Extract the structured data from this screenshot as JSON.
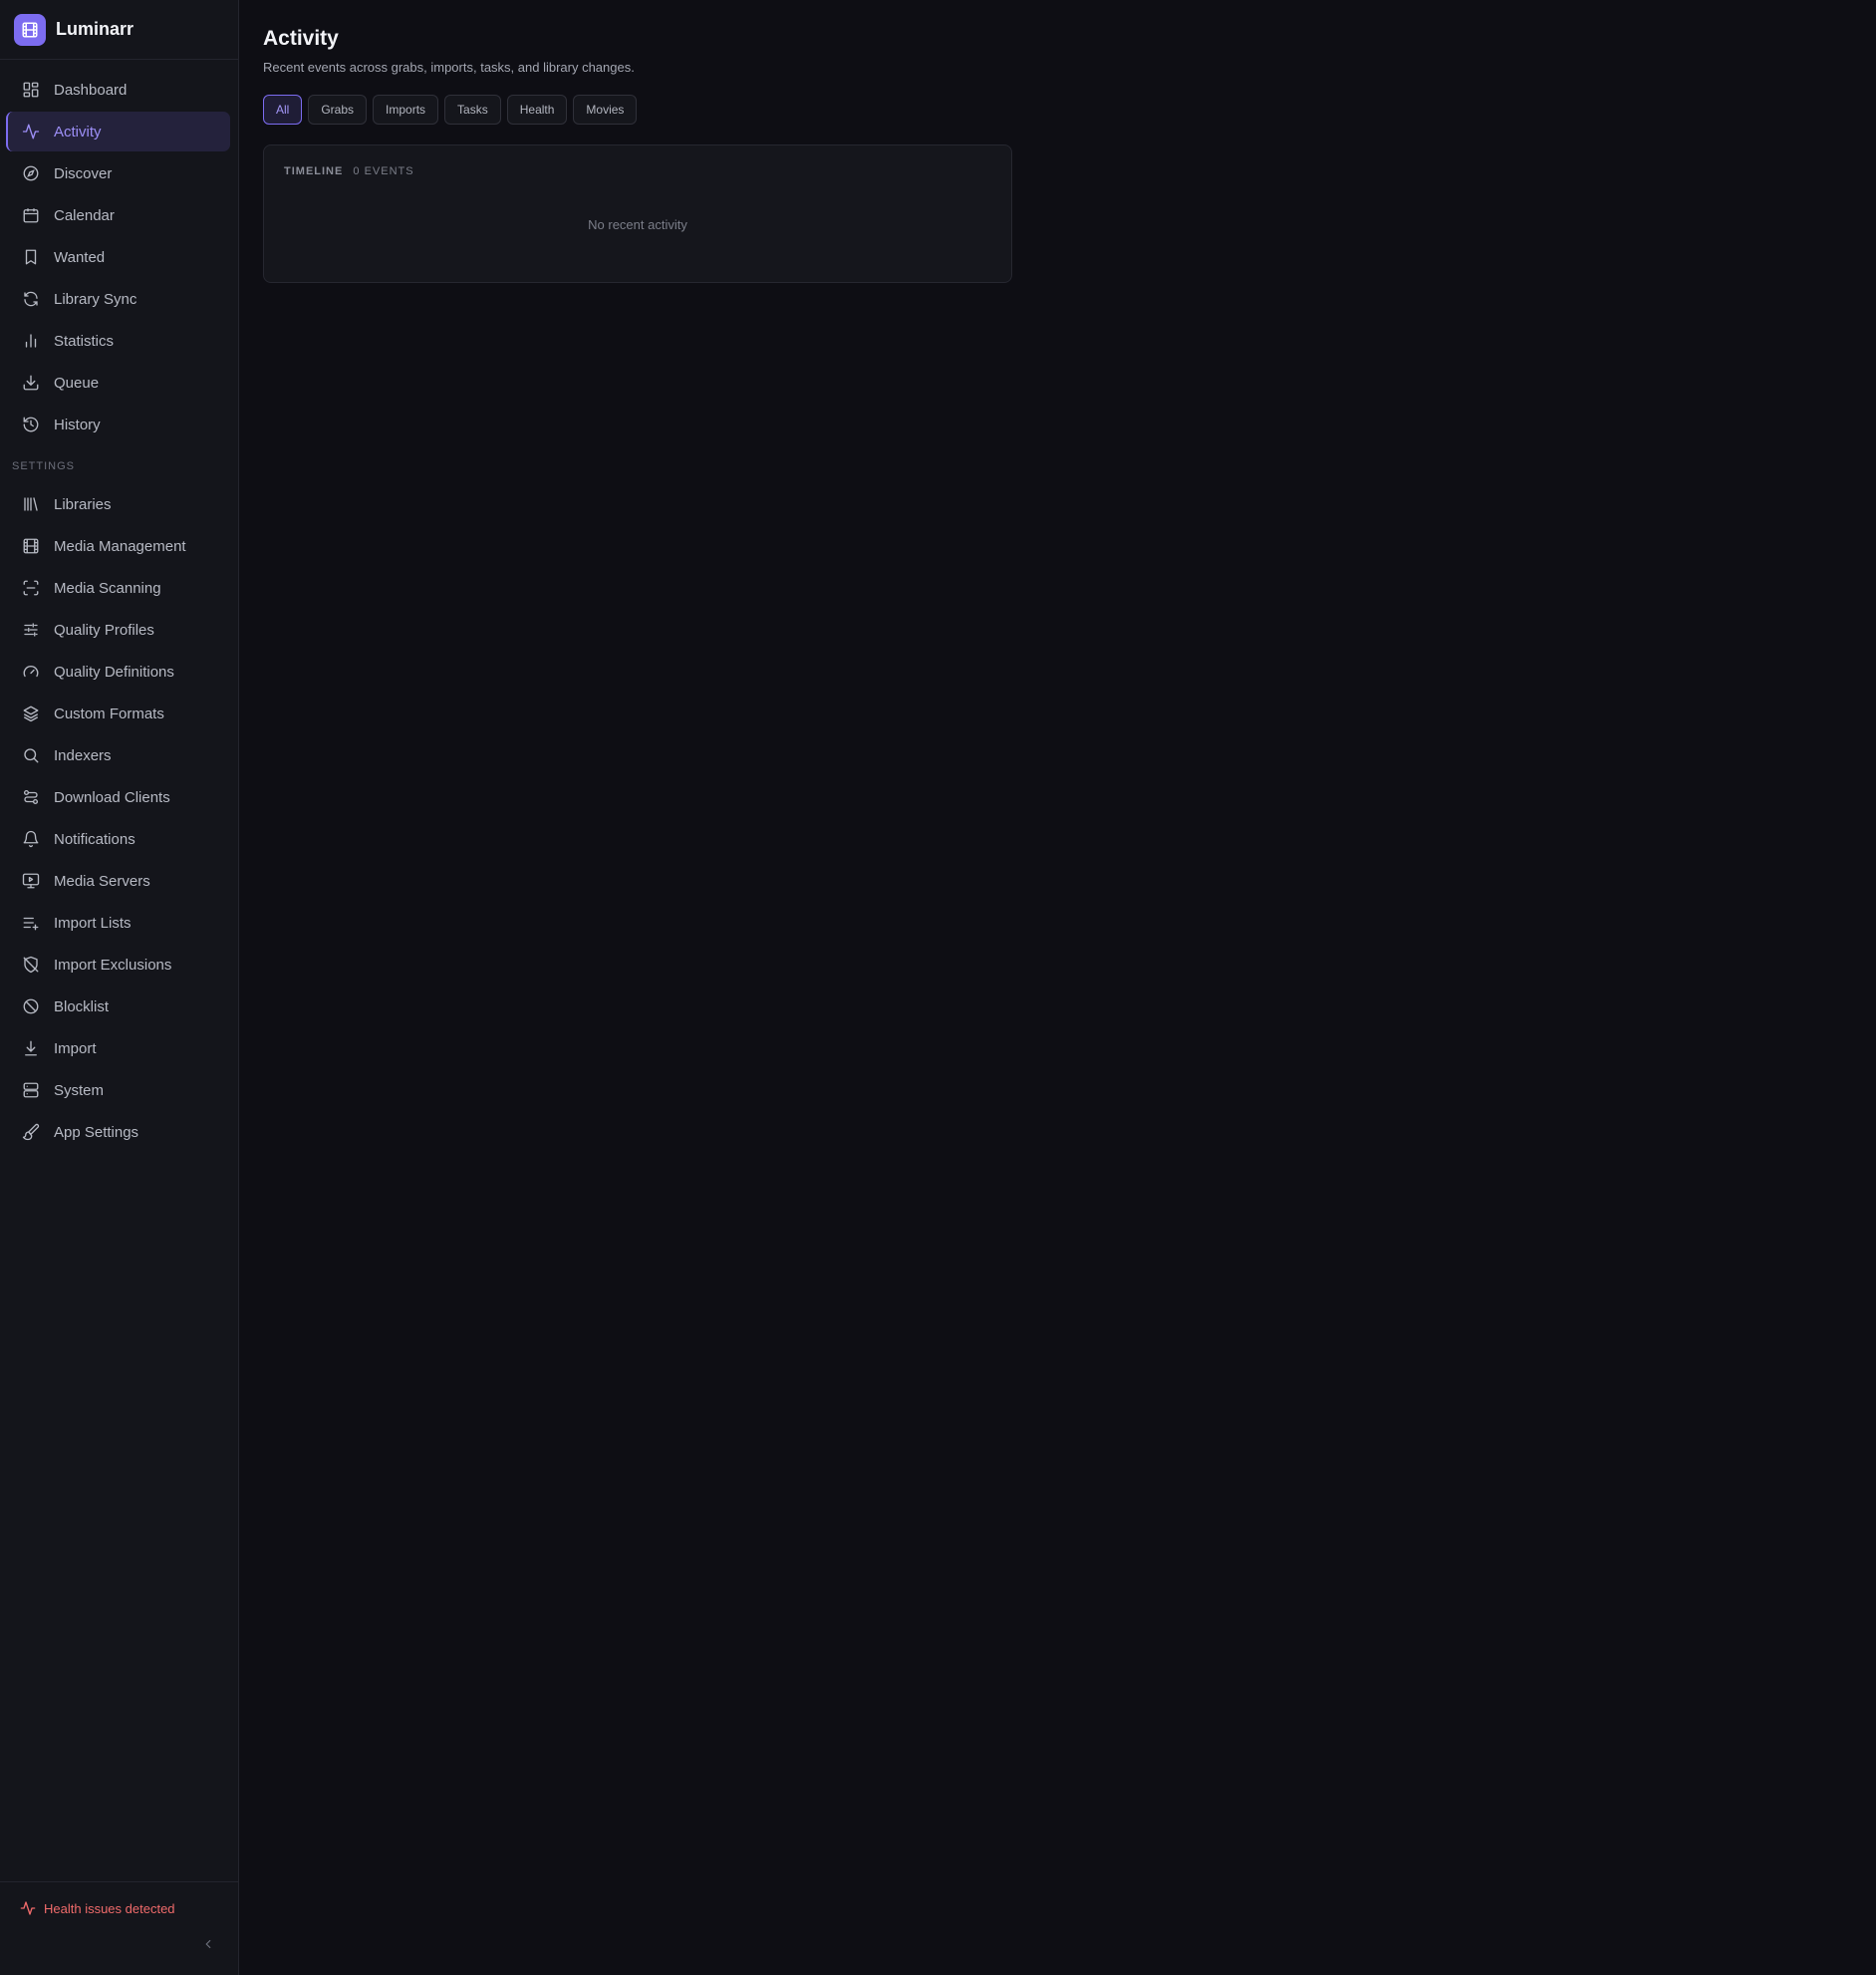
{
  "app": {
    "name": "Luminarr"
  },
  "sidebar": {
    "items": [
      {
        "label": "Dashboard",
        "icon": "dashboard-icon"
      },
      {
        "label": "Activity",
        "icon": "activity-icon",
        "active": true
      },
      {
        "label": "Discover",
        "icon": "compass-icon"
      },
      {
        "label": "Calendar",
        "icon": "calendar-icon"
      },
      {
        "label": "Wanted",
        "icon": "bookmark-icon"
      },
      {
        "label": "Library Sync",
        "icon": "refresh-icon"
      },
      {
        "label": "Statistics",
        "icon": "bar-chart-icon"
      },
      {
        "label": "Queue",
        "icon": "download-icon"
      },
      {
        "label": "History",
        "icon": "history-icon"
      }
    ],
    "settings_label": "SETTINGS",
    "settings_items": [
      {
        "label": "Libraries",
        "icon": "library-icon"
      },
      {
        "label": "Media Management",
        "icon": "film-icon"
      },
      {
        "label": "Media Scanning",
        "icon": "scan-icon"
      },
      {
        "label": "Quality Profiles",
        "icon": "sliders-icon"
      },
      {
        "label": "Quality Definitions",
        "icon": "gauge-icon"
      },
      {
        "label": "Custom Formats",
        "icon": "layers-icon"
      },
      {
        "label": "Indexers",
        "icon": "search-icon"
      },
      {
        "label": "Download Clients",
        "icon": "route-icon"
      },
      {
        "label": "Notifications",
        "icon": "bell-icon"
      },
      {
        "label": "Media Servers",
        "icon": "monitor-icon"
      },
      {
        "label": "Import Lists",
        "icon": "list-plus-icon"
      },
      {
        "label": "Import Exclusions",
        "icon": "shield-off-icon"
      },
      {
        "label": "Blocklist",
        "icon": "ban-icon"
      },
      {
        "label": "Import",
        "icon": "arrow-down-to-line-icon"
      },
      {
        "label": "System",
        "icon": "server-icon"
      },
      {
        "label": "App Settings",
        "icon": "paintbrush-icon"
      }
    ],
    "health_text": "Health issues detected"
  },
  "main": {
    "title": "Activity",
    "subtitle": "Recent events across grabs, imports, tasks, and library changes.",
    "filters": [
      "All",
      "Grabs",
      "Imports",
      "Tasks",
      "Health",
      "Movies"
    ],
    "active_filter": "All",
    "timeline": {
      "title": "TIMELINE",
      "count": "0 EVENTS",
      "empty_text": "No recent activity"
    }
  },
  "colors": {
    "accent": "#7c6cf0",
    "background": "#0e0e14",
    "sidebar": "#14151b",
    "danger": "#f06b6b"
  }
}
